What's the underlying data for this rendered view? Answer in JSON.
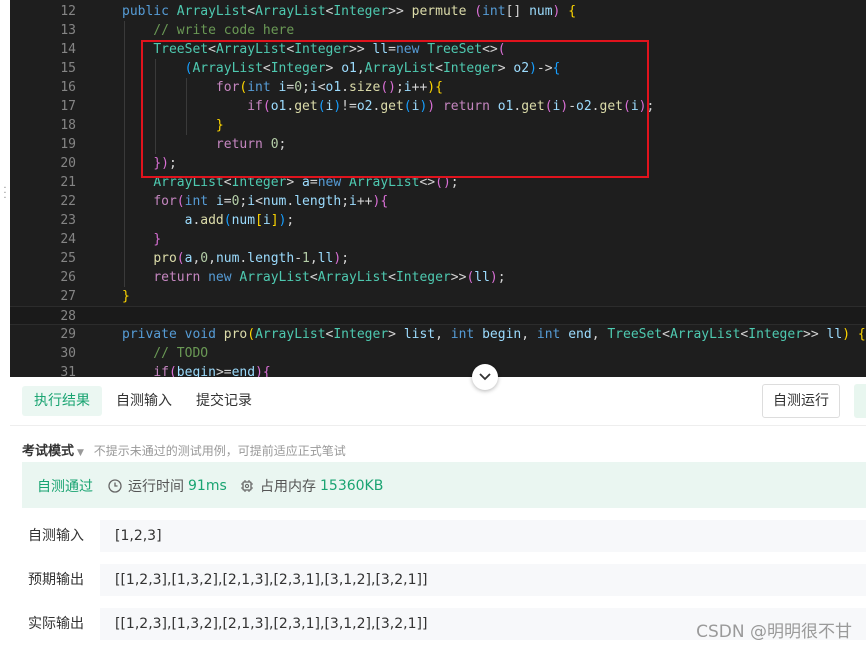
{
  "editor": {
    "lines": [
      {
        "n": "12",
        "tokens": [
          {
            "t": "public ",
            "c": "kw"
          },
          {
            "t": "ArrayList",
            "c": "type"
          },
          {
            "t": "<",
            "c": "pl"
          },
          {
            "t": "ArrayList",
            "c": "type"
          },
          {
            "t": "<",
            "c": "pl"
          },
          {
            "t": "Integer",
            "c": "type"
          },
          {
            "t": ">> ",
            "c": "pl"
          },
          {
            "t": "permute",
            "c": "fn"
          },
          {
            "t": " (",
            "c": "br2"
          },
          {
            "t": "int",
            "c": "kw"
          },
          {
            "t": "[] ",
            "c": "pl"
          },
          {
            "t": "num",
            "c": "var"
          },
          {
            "t": ") ",
            "c": "br2"
          },
          {
            "t": "{",
            "c": "br1"
          }
        ]
      },
      {
        "n": "13",
        "tokens": [
          {
            "t": "    // write code here",
            "c": "com"
          }
        ]
      },
      {
        "n": "14",
        "tokens": [
          {
            "t": "    ",
            "c": "pl"
          },
          {
            "t": "TreeSet",
            "c": "type"
          },
          {
            "t": "<",
            "c": "pl"
          },
          {
            "t": "ArrayList",
            "c": "type"
          },
          {
            "t": "<",
            "c": "pl"
          },
          {
            "t": "Integer",
            "c": "type"
          },
          {
            "t": ">> ",
            "c": "pl"
          },
          {
            "t": "ll",
            "c": "var"
          },
          {
            "t": "=",
            "c": "pl"
          },
          {
            "t": "new ",
            "c": "kw"
          },
          {
            "t": "TreeSet",
            "c": "type"
          },
          {
            "t": "<>",
            "c": "pl"
          },
          {
            "t": "(",
            "c": "br2"
          }
        ]
      },
      {
        "n": "15",
        "tokens": [
          {
            "t": "        ",
            "c": "pl"
          },
          {
            "t": "(",
            "c": "br3"
          },
          {
            "t": "ArrayList",
            "c": "type"
          },
          {
            "t": "<",
            "c": "pl"
          },
          {
            "t": "Integer",
            "c": "type"
          },
          {
            "t": "> ",
            "c": "pl"
          },
          {
            "t": "o1",
            "c": "var"
          },
          {
            "t": ",",
            "c": "pl"
          },
          {
            "t": "ArrayList",
            "c": "type"
          },
          {
            "t": "<",
            "c": "pl"
          },
          {
            "t": "Integer",
            "c": "type"
          },
          {
            "t": "> ",
            "c": "pl"
          },
          {
            "t": "o2",
            "c": "var"
          },
          {
            "t": ")",
            "c": "br3"
          },
          {
            "t": "->",
            "c": "pl"
          },
          {
            "t": "{",
            "c": "br3"
          }
        ]
      },
      {
        "n": "16",
        "tokens": [
          {
            "t": "            ",
            "c": "pl"
          },
          {
            "t": "for",
            "c": "ctl"
          },
          {
            "t": "(",
            "c": "br1"
          },
          {
            "t": "int ",
            "c": "kw"
          },
          {
            "t": "i",
            "c": "var"
          },
          {
            "t": "=",
            "c": "pl"
          },
          {
            "t": "0",
            "c": "num"
          },
          {
            "t": ";",
            "c": "pl"
          },
          {
            "t": "i",
            "c": "var"
          },
          {
            "t": "<",
            "c": "pl"
          },
          {
            "t": "o1",
            "c": "var"
          },
          {
            "t": ".",
            "c": "pl"
          },
          {
            "t": "size",
            "c": "fn"
          },
          {
            "t": "()",
            "c": "br2"
          },
          {
            "t": ";",
            "c": "pl"
          },
          {
            "t": "i",
            "c": "var"
          },
          {
            "t": "++",
            "c": "pl"
          },
          {
            "t": ")",
            "c": "br1"
          },
          {
            "t": "{",
            "c": "br1"
          }
        ]
      },
      {
        "n": "17",
        "tokens": [
          {
            "t": "                ",
            "c": "pl"
          },
          {
            "t": "if",
            "c": "ctl"
          },
          {
            "t": "(",
            "c": "br2"
          },
          {
            "t": "o1",
            "c": "var"
          },
          {
            "t": ".",
            "c": "pl"
          },
          {
            "t": "get",
            "c": "fn"
          },
          {
            "t": "(",
            "c": "br3"
          },
          {
            "t": "i",
            "c": "var"
          },
          {
            "t": ")",
            "c": "br3"
          },
          {
            "t": "!=",
            "c": "pl"
          },
          {
            "t": "o2",
            "c": "var"
          },
          {
            "t": ".",
            "c": "pl"
          },
          {
            "t": "get",
            "c": "fn"
          },
          {
            "t": "(",
            "c": "br3"
          },
          {
            "t": "i",
            "c": "var"
          },
          {
            "t": ")",
            "c": "br3"
          },
          {
            "t": ") ",
            "c": "br2"
          },
          {
            "t": "return ",
            "c": "ctl"
          },
          {
            "t": "o1",
            "c": "var"
          },
          {
            "t": ".",
            "c": "pl"
          },
          {
            "t": "get",
            "c": "fn"
          },
          {
            "t": "(",
            "c": "br2"
          },
          {
            "t": "i",
            "c": "var"
          },
          {
            "t": ")",
            "c": "br2"
          },
          {
            "t": "-",
            "c": "pl"
          },
          {
            "t": "o2",
            "c": "var"
          },
          {
            "t": ".",
            "c": "pl"
          },
          {
            "t": "get",
            "c": "fn"
          },
          {
            "t": "(",
            "c": "br2"
          },
          {
            "t": "i",
            "c": "var"
          },
          {
            "t": ")",
            "c": "br2"
          },
          {
            "t": ";",
            "c": "pl"
          }
        ]
      },
      {
        "n": "18",
        "tokens": [
          {
            "t": "            ",
            "c": "pl"
          },
          {
            "t": "}",
            "c": "br1"
          }
        ]
      },
      {
        "n": "19",
        "tokens": [
          {
            "t": "            ",
            "c": "pl"
          },
          {
            "t": "return ",
            "c": "ctl"
          },
          {
            "t": "0",
            "c": "num"
          },
          {
            "t": ";",
            "c": "pl"
          }
        ]
      },
      {
        "n": "20",
        "tokens": [
          {
            "t": "    ",
            "c": "pl"
          },
          {
            "t": "})",
            "c": "br2"
          },
          {
            "t": ";",
            "c": "pl"
          }
        ]
      },
      {
        "n": "21",
        "tokens": [
          {
            "t": "    ",
            "c": "pl"
          },
          {
            "t": "ArrayList",
            "c": "type"
          },
          {
            "t": "<",
            "c": "pl"
          },
          {
            "t": "Integer",
            "c": "type"
          },
          {
            "t": "> ",
            "c": "pl"
          },
          {
            "t": "a",
            "c": "var"
          },
          {
            "t": "=",
            "c": "pl"
          },
          {
            "t": "new ",
            "c": "kw"
          },
          {
            "t": "ArrayList",
            "c": "type"
          },
          {
            "t": "<>",
            "c": "pl"
          },
          {
            "t": "()",
            "c": "br2"
          },
          {
            "t": ";",
            "c": "pl"
          }
        ]
      },
      {
        "n": "22",
        "tokens": [
          {
            "t": "    ",
            "c": "pl"
          },
          {
            "t": "for",
            "c": "ctl"
          },
          {
            "t": "(",
            "c": "br2"
          },
          {
            "t": "int ",
            "c": "kw"
          },
          {
            "t": "i",
            "c": "var"
          },
          {
            "t": "=",
            "c": "pl"
          },
          {
            "t": "0",
            "c": "num"
          },
          {
            "t": ";",
            "c": "pl"
          },
          {
            "t": "i",
            "c": "var"
          },
          {
            "t": "<",
            "c": "pl"
          },
          {
            "t": "num",
            "c": "var"
          },
          {
            "t": ".",
            "c": "pl"
          },
          {
            "t": "length",
            "c": "var"
          },
          {
            "t": ";",
            "c": "pl"
          },
          {
            "t": "i",
            "c": "var"
          },
          {
            "t": "++",
            "c": "pl"
          },
          {
            "t": ")",
            "c": "br2"
          },
          {
            "t": "{",
            "c": "br2"
          }
        ]
      },
      {
        "n": "23",
        "tokens": [
          {
            "t": "        ",
            "c": "pl"
          },
          {
            "t": "a",
            "c": "var"
          },
          {
            "t": ".",
            "c": "pl"
          },
          {
            "t": "add",
            "c": "fn"
          },
          {
            "t": "(",
            "c": "br3"
          },
          {
            "t": "num",
            "c": "var"
          },
          {
            "t": "[",
            "c": "br1"
          },
          {
            "t": "i",
            "c": "var"
          },
          {
            "t": "]",
            "c": "br1"
          },
          {
            "t": ")",
            "c": "br3"
          },
          {
            "t": ";",
            "c": "pl"
          }
        ]
      },
      {
        "n": "24",
        "tokens": [
          {
            "t": "    ",
            "c": "pl"
          },
          {
            "t": "}",
            "c": "br2"
          }
        ]
      },
      {
        "n": "25",
        "tokens": [
          {
            "t": "    ",
            "c": "pl"
          },
          {
            "t": "pro",
            "c": "fn"
          },
          {
            "t": "(",
            "c": "br2"
          },
          {
            "t": "a",
            "c": "var"
          },
          {
            "t": ",",
            "c": "pl"
          },
          {
            "t": "0",
            "c": "num"
          },
          {
            "t": ",",
            "c": "pl"
          },
          {
            "t": "num",
            "c": "var"
          },
          {
            "t": ".",
            "c": "pl"
          },
          {
            "t": "length",
            "c": "var"
          },
          {
            "t": "-",
            "c": "pl"
          },
          {
            "t": "1",
            "c": "num"
          },
          {
            "t": ",",
            "c": "pl"
          },
          {
            "t": "ll",
            "c": "var"
          },
          {
            "t": ")",
            "c": "br2"
          },
          {
            "t": ";",
            "c": "pl"
          }
        ]
      },
      {
        "n": "26",
        "tokens": [
          {
            "t": "    ",
            "c": "pl"
          },
          {
            "t": "return ",
            "c": "ctl"
          },
          {
            "t": "new ",
            "c": "kw"
          },
          {
            "t": "ArrayList",
            "c": "type"
          },
          {
            "t": "<",
            "c": "pl"
          },
          {
            "t": "ArrayList",
            "c": "type"
          },
          {
            "t": "<",
            "c": "pl"
          },
          {
            "t": "Integer",
            "c": "type"
          },
          {
            "t": ">>",
            "c": "pl"
          },
          {
            "t": "(",
            "c": "br2"
          },
          {
            "t": "ll",
            "c": "var"
          },
          {
            "t": ")",
            "c": "br2"
          },
          {
            "t": ";",
            "c": "pl"
          }
        ]
      },
      {
        "n": "27",
        "tokens": [
          {
            "t": "}",
            "c": "br1"
          }
        ]
      },
      {
        "n": "28",
        "tokens": []
      },
      {
        "n": "29",
        "tokens": [
          {
            "t": "private ",
            "c": "kw"
          },
          {
            "t": "void ",
            "c": "kw"
          },
          {
            "t": "pro",
            "c": "fn"
          },
          {
            "t": "(",
            "c": "br1"
          },
          {
            "t": "ArrayList",
            "c": "type"
          },
          {
            "t": "<",
            "c": "pl"
          },
          {
            "t": "Integer",
            "c": "type"
          },
          {
            "t": "> ",
            "c": "pl"
          },
          {
            "t": "list",
            "c": "var"
          },
          {
            "t": ", ",
            "c": "pl"
          },
          {
            "t": "int ",
            "c": "kw"
          },
          {
            "t": "begin",
            "c": "var"
          },
          {
            "t": ", ",
            "c": "pl"
          },
          {
            "t": "int ",
            "c": "kw"
          },
          {
            "t": "end",
            "c": "var"
          },
          {
            "t": ", ",
            "c": "pl"
          },
          {
            "t": "TreeSet",
            "c": "type"
          },
          {
            "t": "<",
            "c": "pl"
          },
          {
            "t": "ArrayList",
            "c": "type"
          },
          {
            "t": "<",
            "c": "pl"
          },
          {
            "t": "Integer",
            "c": "type"
          },
          {
            "t": ">> ",
            "c": "pl"
          },
          {
            "t": "ll",
            "c": "var"
          },
          {
            "t": ") ",
            "c": "br1"
          },
          {
            "t": "{",
            "c": "br1"
          }
        ]
      },
      {
        "n": "30",
        "tokens": [
          {
            "t": "    // TODO",
            "c": "com"
          }
        ]
      },
      {
        "n": "31",
        "tokens": [
          {
            "t": "    ",
            "c": "pl"
          },
          {
            "t": "if",
            "c": "ctl"
          },
          {
            "t": "(",
            "c": "br2"
          },
          {
            "t": "begin",
            "c": "var"
          },
          {
            "t": ">=",
            "c": "pl"
          },
          {
            "t": "end",
            "c": "var"
          },
          {
            "t": ")",
            "c": "br2"
          },
          {
            "t": "{",
            "c": "br2"
          }
        ]
      }
    ],
    "current_line": "28",
    "colors": {
      "highlight_box": "#e0131d",
      "background": "#1e1e1e"
    }
  },
  "tabs": {
    "result": "执行结果",
    "self_input": "自测输入",
    "history": "提交记录",
    "active": "result"
  },
  "toolbar": {
    "run_label": "自测运行"
  },
  "exam": {
    "mode_label": "考试模式",
    "hint": "不提示未通过的测试用例，可提前适应正式笔试"
  },
  "status": {
    "pass_label": "自测通过",
    "time_label": "运行时间",
    "time_value": "91ms",
    "mem_label": "占用内存",
    "mem_value": "15360KB",
    "time_icon": "clock-icon",
    "mem_icon": "chip-icon",
    "accent_color": "#1aa472"
  },
  "io": {
    "input_label": "自测输入",
    "input_value": "[1,2,3]",
    "expected_label": "预期输出",
    "expected_value": "[[1,2,3],[1,3,2],[2,1,3],[2,3,1],[3,1,2],[3,2,1]]",
    "actual_label": "实际输出",
    "actual_value": "[[1,2,3],[1,3,2],[2,1,3],[2,3,1],[3,1,2],[3,2,1]]"
  },
  "watermark": "CSDN @明明很不甘"
}
